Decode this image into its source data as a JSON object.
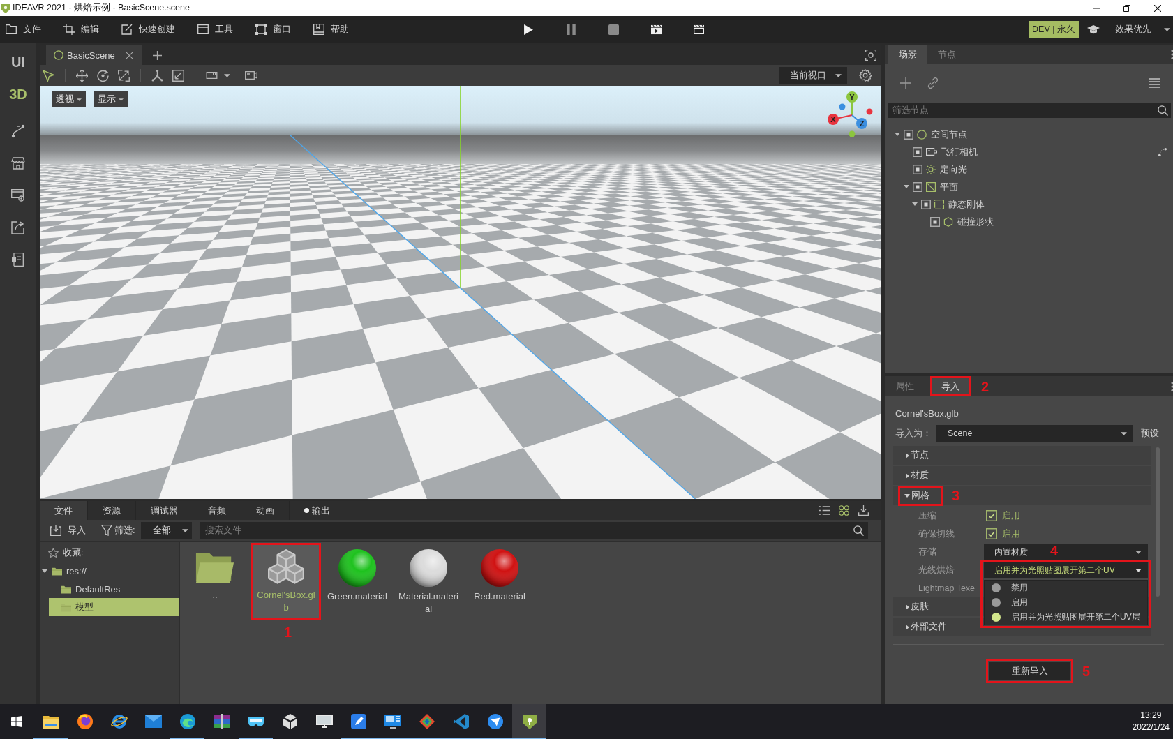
{
  "window": {
    "title": "IDEAVR 2021 - 烘焙示例 - BasicScene.scene"
  },
  "menu": {
    "items": [
      {
        "label": "文件"
      },
      {
        "label": "编辑"
      },
      {
        "label": "快速创建"
      },
      {
        "label": "工具"
      },
      {
        "label": "窗口"
      },
      {
        "label": "帮助"
      }
    ],
    "license_badge": "DEV | 永久",
    "quality": "效果优先"
  },
  "sidebar": {
    "modes": [
      {
        "label": "UI",
        "selected": false
      },
      {
        "label": "3D",
        "selected": true
      }
    ]
  },
  "editor_tabs": [
    {
      "label": "BasicScene",
      "selected": true
    }
  ],
  "viewport": {
    "tools": [
      {
        "selected": true
      },
      {
        "selected": false
      },
      {
        "selected": false
      },
      {
        "selected": false
      }
    ],
    "view_dropdown": "当前视口",
    "buttons": [
      {
        "label": "透视"
      },
      {
        "label": "显示"
      }
    ],
    "gizmo": [
      {
        "label": "Y",
        "color": "#8cc63f"
      },
      {
        "label": "X",
        "color": "#e8343f"
      },
      {
        "label": "Z",
        "color": "#3b8fe0"
      }
    ]
  },
  "scene_panel": {
    "tabs": [
      {
        "label": "场景",
        "selected": true
      },
      {
        "label": "节点",
        "selected": false
      }
    ],
    "filter": {
      "placeholder": "筛选节点"
    },
    "tree": [
      {
        "label": "空间节点",
        "kind": "spatial",
        "visible": true,
        "script": false,
        "expanded": true,
        "children": [
          {
            "label": "飞行相机",
            "kind": "camera",
            "visible": true,
            "script": true
          },
          {
            "label": "定向光",
            "kind": "light",
            "visible": true,
            "script": false
          },
          {
            "label": "平面",
            "kind": "mesh",
            "visible": true,
            "script": false,
            "expanded": true,
            "children": [
              {
                "label": "静态刚体",
                "kind": "body",
                "visible": true,
                "script": false,
                "expanded": true,
                "children": [
                  {
                    "label": "碰撞形状",
                    "kind": "shape",
                    "visible": true,
                    "script": false
                  }
                ]
              }
            ]
          }
        ]
      }
    ]
  },
  "import_panel": {
    "tabs": [
      {
        "label": "属性",
        "selected": false
      },
      {
        "label": "导入",
        "selected": true,
        "annotation": "2"
      }
    ],
    "file_name": "Cornel'sBox.glb",
    "import_as": {
      "label": "导入为：",
      "value": "Scene",
      "preset": "预设"
    },
    "sections": [
      {
        "label": "节点",
        "expanded": false
      },
      {
        "label": "材质",
        "expanded": false
      },
      {
        "label": "网格",
        "expanded": true,
        "annotation": "3",
        "properties": [
          {
            "kind": "checkbox",
            "label": "压缩",
            "checked": true,
            "text": "启用"
          },
          {
            "kind": "checkbox",
            "label": "确保切线",
            "checked": true,
            "text": "启用"
          },
          {
            "kind": "select",
            "label": "存储",
            "value": "内置材质",
            "open": false
          },
          {
            "kind": "select",
            "label": "光线烘焙",
            "value": "启用并为光照贴图展开第二个UV",
            "open": true,
            "annotation": "4",
            "options": [
              {
                "label": "禁用",
                "selected": false
              },
              {
                "label": "启用",
                "selected": false
              },
              {
                "label": "启用并为光照贴图展开第二个UV层",
                "selected": true
              }
            ]
          },
          {
            "kind": "text",
            "label": "Lightmap Texe"
          }
        ]
      },
      {
        "label": "皮肤",
        "expanded": false
      },
      {
        "label": "外部文件",
        "expanded": false
      }
    ],
    "reimport_button": {
      "label": "重新导入",
      "annotation": "5"
    }
  },
  "file_panel": {
    "tabs": [
      {
        "label": "文件",
        "selected": true,
        "dot": false
      },
      {
        "label": "资源",
        "selected": false,
        "dot": false
      },
      {
        "label": "调试器",
        "selected": false,
        "dot": false
      },
      {
        "label": "音频",
        "selected": false,
        "dot": false
      },
      {
        "label": "动画",
        "selected": false,
        "dot": false
      },
      {
        "label": "输出",
        "selected": false,
        "dot": true
      }
    ],
    "view_modes": [
      {
        "selected": false
      },
      {
        "selected": true
      }
    ],
    "toolbar": {
      "import_label": "导入",
      "filter_label": "筛选:",
      "filter_value": "全部",
      "search": {
        "placeholder": "搜索文件"
      }
    },
    "tree": [
      {
        "label": "收藏:",
        "kind": "favorites",
        "selected": false
      },
      {
        "label": "res://",
        "kind": "folder",
        "selected": false,
        "expanded": true,
        "children": [
          {
            "label": "DefaultRes",
            "kind": "folder",
            "selected": false
          },
          {
            "label": "模型",
            "kind": "folder",
            "selected": true
          }
        ]
      }
    ],
    "files": [
      {
        "name": "..",
        "kind": "folder",
        "selected": false
      },
      {
        "name": "Cornel'sBox.glb",
        "kind": "model",
        "selected": true,
        "annotation": "1"
      },
      {
        "name": "Green.material",
        "kind": "material",
        "color": "#1ec21e",
        "selected": false
      },
      {
        "name": "Material.material",
        "kind": "material",
        "color": "#dcdcdc",
        "selected": false
      },
      {
        "name": "Red.material",
        "kind": "material",
        "color": "#d01212",
        "selected": false
      }
    ]
  },
  "taskbar": {
    "apps": [
      {
        "running": true,
        "selected": false
      },
      {
        "running": false,
        "selected": false
      },
      {
        "running": false,
        "selected": false
      },
      {
        "running": false,
        "selected": false
      },
      {
        "running": true,
        "selected": false
      },
      {
        "running": false,
        "selected": false
      },
      {
        "running": true,
        "selected": false
      },
      {
        "running": false,
        "selected": false
      },
      {
        "running": false,
        "selected": false
      },
      {
        "running": true,
        "selected": false
      },
      {
        "running": true,
        "selected": false
      },
      {
        "running": true,
        "selected": false
      },
      {
        "running": true,
        "selected": false
      },
      {
        "running": true,
        "selected": false
      },
      {
        "running": true,
        "selected": true
      }
    ],
    "time": "13:29",
    "date": "2022/1/24"
  }
}
